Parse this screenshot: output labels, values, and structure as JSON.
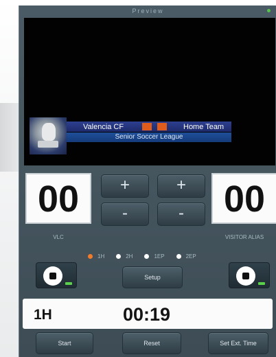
{
  "window": {
    "title": "Preview"
  },
  "preview": {
    "home_team": "Valencia CF",
    "away_team": "Home Team",
    "league": "Senior Soccer League"
  },
  "home": {
    "score": "00",
    "label": "VLC"
  },
  "visitor": {
    "score": "00",
    "label": "VISITOR ALIAS"
  },
  "score_buttons": {
    "plus": "+",
    "minus": "-"
  },
  "periods": [
    {
      "label": "1H",
      "selected": true
    },
    {
      "label": "2H",
      "selected": false
    },
    {
      "label": "1EP",
      "selected": false
    },
    {
      "label": "2EP",
      "selected": false
    }
  ],
  "buttons": {
    "setup": "Setup",
    "start": "Start",
    "reset": "Reset",
    "set_ext_time": "Set Ext. Time"
  },
  "clock": {
    "period": "1H",
    "time": "00:19"
  },
  "colors": {
    "panel": "#46565f",
    "accent_orange": "#f17a2b",
    "led_green": "#5bd14b",
    "league_blue": "#1f4f9a"
  }
}
